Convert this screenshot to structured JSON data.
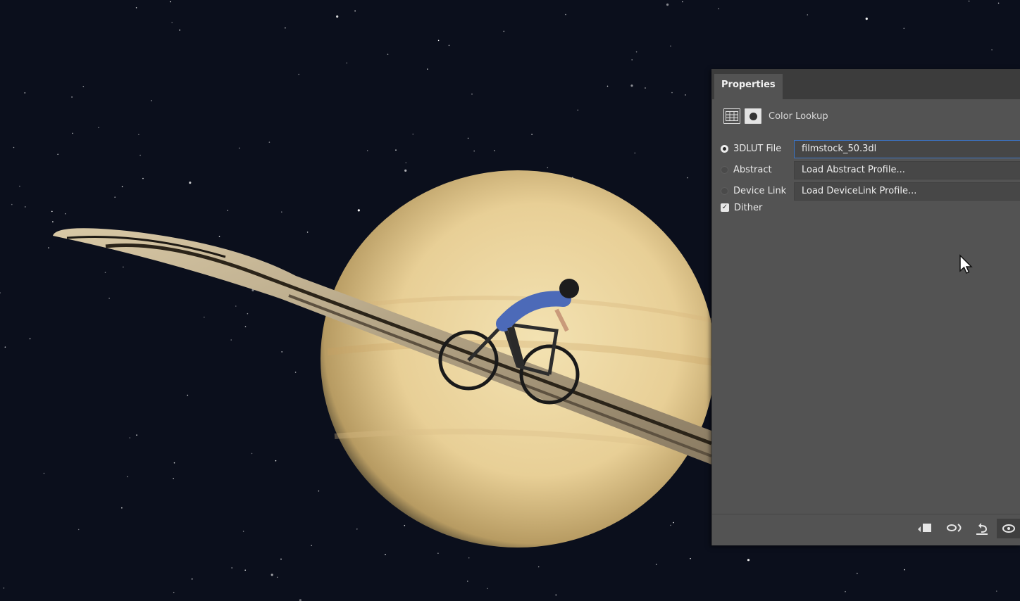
{
  "panel": {
    "tab_label": "Properties",
    "header": {
      "grid_icon": "adjustment-grid-icon",
      "mask_icon": "layer-mask-icon",
      "title": "Color Lookup"
    },
    "options": [
      {
        "label": "3DLUT File",
        "selected": true,
        "value": "filmstock_50.3dl"
      },
      {
        "label": "Abstract",
        "selected": false,
        "value": "Load Abstract Profile..."
      },
      {
        "label": "Device Link",
        "selected": false,
        "value": "Load DeviceLink Profile..."
      }
    ],
    "dither": {
      "label": "Dither",
      "checked": true
    },
    "footer_icons": [
      "clip-to-layer-icon",
      "view-previous-state-icon",
      "reset-icon",
      "visibility-eye-icon"
    ]
  },
  "colors": {
    "space": "#0b0f1c",
    "panel_bg": "#535353",
    "tab_strip": "#3c3c3c",
    "focus_border": "#3b74c5"
  }
}
